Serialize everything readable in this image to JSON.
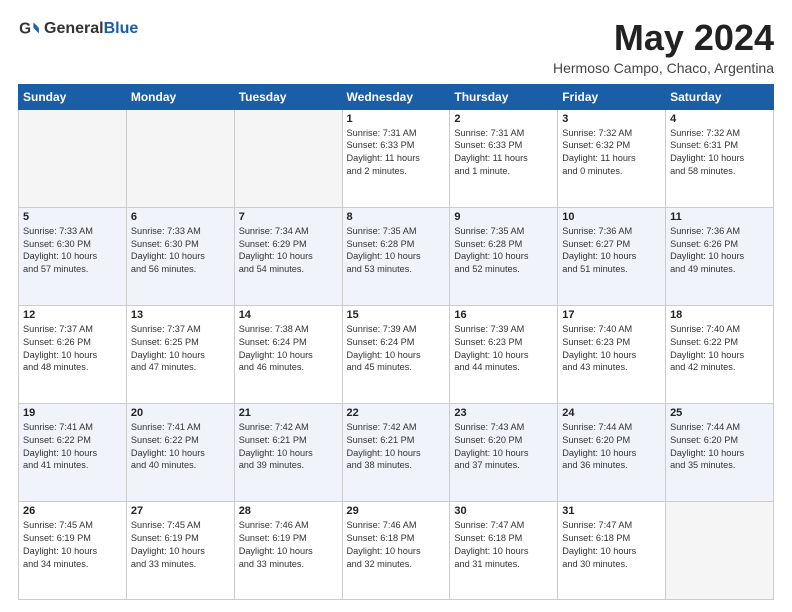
{
  "header": {
    "logo": {
      "text1": "General",
      "text2": "Blue"
    },
    "title": "May 2024",
    "subtitle": "Hermoso Campo, Chaco, Argentina"
  },
  "calendar": {
    "days_of_week": [
      "Sunday",
      "Monday",
      "Tuesday",
      "Wednesday",
      "Thursday",
      "Friday",
      "Saturday"
    ],
    "rows": [
      {
        "style": "white",
        "cells": [
          {
            "empty": true
          },
          {
            "empty": true
          },
          {
            "empty": true
          },
          {
            "day": "1",
            "info": "Sunrise: 7:31 AM\nSunset: 6:33 PM\nDaylight: 11 hours\nand 2 minutes."
          },
          {
            "day": "2",
            "info": "Sunrise: 7:31 AM\nSunset: 6:33 PM\nDaylight: 11 hours\nand 1 minute."
          },
          {
            "day": "3",
            "info": "Sunrise: 7:32 AM\nSunset: 6:32 PM\nDaylight: 11 hours\nand 0 minutes."
          },
          {
            "day": "4",
            "info": "Sunrise: 7:32 AM\nSunset: 6:31 PM\nDaylight: 10 hours\nand 58 minutes."
          }
        ]
      },
      {
        "style": "blue",
        "cells": [
          {
            "day": "5",
            "info": "Sunrise: 7:33 AM\nSunset: 6:30 PM\nDaylight: 10 hours\nand 57 minutes."
          },
          {
            "day": "6",
            "info": "Sunrise: 7:33 AM\nSunset: 6:30 PM\nDaylight: 10 hours\nand 56 minutes."
          },
          {
            "day": "7",
            "info": "Sunrise: 7:34 AM\nSunset: 6:29 PM\nDaylight: 10 hours\nand 54 minutes."
          },
          {
            "day": "8",
            "info": "Sunrise: 7:35 AM\nSunset: 6:28 PM\nDaylight: 10 hours\nand 53 minutes."
          },
          {
            "day": "9",
            "info": "Sunrise: 7:35 AM\nSunset: 6:28 PM\nDaylight: 10 hours\nand 52 minutes."
          },
          {
            "day": "10",
            "info": "Sunrise: 7:36 AM\nSunset: 6:27 PM\nDaylight: 10 hours\nand 51 minutes."
          },
          {
            "day": "11",
            "info": "Sunrise: 7:36 AM\nSunset: 6:26 PM\nDaylight: 10 hours\nand 49 minutes."
          }
        ]
      },
      {
        "style": "white",
        "cells": [
          {
            "day": "12",
            "info": "Sunrise: 7:37 AM\nSunset: 6:26 PM\nDaylight: 10 hours\nand 48 minutes."
          },
          {
            "day": "13",
            "info": "Sunrise: 7:37 AM\nSunset: 6:25 PM\nDaylight: 10 hours\nand 47 minutes."
          },
          {
            "day": "14",
            "info": "Sunrise: 7:38 AM\nSunset: 6:24 PM\nDaylight: 10 hours\nand 46 minutes."
          },
          {
            "day": "15",
            "info": "Sunrise: 7:39 AM\nSunset: 6:24 PM\nDaylight: 10 hours\nand 45 minutes."
          },
          {
            "day": "16",
            "info": "Sunrise: 7:39 AM\nSunset: 6:23 PM\nDaylight: 10 hours\nand 44 minutes."
          },
          {
            "day": "17",
            "info": "Sunrise: 7:40 AM\nSunset: 6:23 PM\nDaylight: 10 hours\nand 43 minutes."
          },
          {
            "day": "18",
            "info": "Sunrise: 7:40 AM\nSunset: 6:22 PM\nDaylight: 10 hours\nand 42 minutes."
          }
        ]
      },
      {
        "style": "blue",
        "cells": [
          {
            "day": "19",
            "info": "Sunrise: 7:41 AM\nSunset: 6:22 PM\nDaylight: 10 hours\nand 41 minutes."
          },
          {
            "day": "20",
            "info": "Sunrise: 7:41 AM\nSunset: 6:22 PM\nDaylight: 10 hours\nand 40 minutes."
          },
          {
            "day": "21",
            "info": "Sunrise: 7:42 AM\nSunset: 6:21 PM\nDaylight: 10 hours\nand 39 minutes."
          },
          {
            "day": "22",
            "info": "Sunrise: 7:42 AM\nSunset: 6:21 PM\nDaylight: 10 hours\nand 38 minutes."
          },
          {
            "day": "23",
            "info": "Sunrise: 7:43 AM\nSunset: 6:20 PM\nDaylight: 10 hours\nand 37 minutes."
          },
          {
            "day": "24",
            "info": "Sunrise: 7:44 AM\nSunset: 6:20 PM\nDaylight: 10 hours\nand 36 minutes."
          },
          {
            "day": "25",
            "info": "Sunrise: 7:44 AM\nSunset: 6:20 PM\nDaylight: 10 hours\nand 35 minutes."
          }
        ]
      },
      {
        "style": "white",
        "cells": [
          {
            "day": "26",
            "info": "Sunrise: 7:45 AM\nSunset: 6:19 PM\nDaylight: 10 hours\nand 34 minutes."
          },
          {
            "day": "27",
            "info": "Sunrise: 7:45 AM\nSunset: 6:19 PM\nDaylight: 10 hours\nand 33 minutes."
          },
          {
            "day": "28",
            "info": "Sunrise: 7:46 AM\nSunset: 6:19 PM\nDaylight: 10 hours\nand 33 minutes."
          },
          {
            "day": "29",
            "info": "Sunrise: 7:46 AM\nSunset: 6:18 PM\nDaylight: 10 hours\nand 32 minutes."
          },
          {
            "day": "30",
            "info": "Sunrise: 7:47 AM\nSunset: 6:18 PM\nDaylight: 10 hours\nand 31 minutes."
          },
          {
            "day": "31",
            "info": "Sunrise: 7:47 AM\nSunset: 6:18 PM\nDaylight: 10 hours\nand 30 minutes."
          },
          {
            "empty": true
          }
        ]
      }
    ]
  }
}
